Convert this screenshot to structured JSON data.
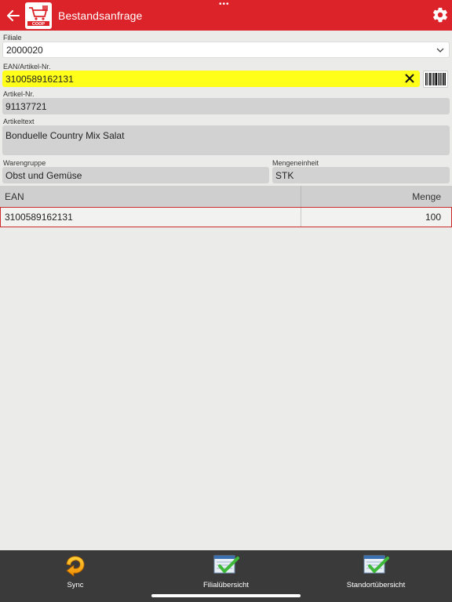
{
  "header": {
    "title": "Bestandsanfrage",
    "dots": "•••",
    "logo_text": "COOP"
  },
  "form": {
    "filiale_label": "Filiale",
    "filiale_value": "2000020",
    "ean_label": "EAN/Artikel-Nr.",
    "ean_value": "3100589162131",
    "artikelnr_label": "Artikel-Nr.",
    "artikelnr_value": "91137721",
    "artikeltext_label": "Artikeltext",
    "artikeltext_value": "Bonduelle Country Mix Salat",
    "warengruppe_label": "Warengruppe",
    "warengruppe_value": "Obst und Gemüse",
    "mengeneinheit_label": "Mengeneinheit",
    "mengeneinheit_value": "STK"
  },
  "table": {
    "columns": [
      "EAN",
      "Menge"
    ],
    "rows": [
      {
        "ean": "3100589162131",
        "menge": "100"
      }
    ]
  },
  "toolbar": {
    "sync_label": "Sync",
    "filial_label": "Filialübersicht",
    "standort_label": "Standortübersicht"
  },
  "colors": {
    "header": "#dc2329",
    "ean_highlight": "#ffff1a",
    "toolbar": "#3a3a3a",
    "check_green": "#3fb93a"
  }
}
